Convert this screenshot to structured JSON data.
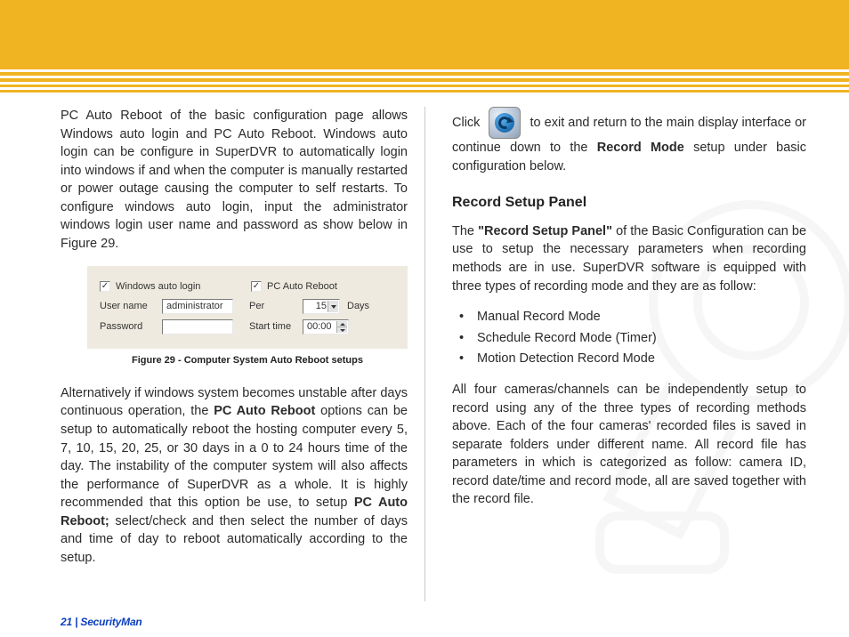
{
  "left": {
    "p1": "PC Auto Reboot of the basic configuration page allows Windows auto login and PC Auto Reboot.  Windows auto login can be configure in SuperDVR to automatically login into windows if and when the computer is manually restarted or power outage causing the computer to self restarts.  To configure windows auto login, input the administrator windows login user name and password as show below in Figure 29.",
    "fig": {
      "chk_win_label": "Windows auto login",
      "chk_pc_label": "PC Auto Reboot",
      "user_label": "User name",
      "user_value": "administrator",
      "per_label": "Per",
      "per_value": "15",
      "per_unit": "Days",
      "pwd_label": "Password",
      "pwd_value": "",
      "start_label": "Start time",
      "start_value": "00:00"
    },
    "caption": "Figure 29 - Computer System Auto Reboot setups",
    "p2a": "Alternatively if windows system becomes unstable after days continuous operation, the ",
    "p2b": "PC Auto Reboot",
    "p2c": " options can be setup to automatically reboot the hosting computer every 5, 7, 10, 15, 20, 25, or 30 days in a 0 to 24 hours time of the day.  The instability of the computer system will also affects the performance of SuperDVR as a whole.  It is highly recommended that this option be use, to setup ",
    "p2d": "PC Auto Reboot;",
    "p2e": " select/check   and then select the number of days and time of day to reboot automatically according to the setup."
  },
  "right": {
    "p1a": "Click ",
    "p1b": " to exit and return to the main display interface or continue down to the ",
    "p1c": "Record Mode",
    "p1d": " setup under basic configuration below.",
    "heading": "Record Setup Panel",
    "p2a": "The ",
    "p2b": "\"Record Setup Panel\"",
    "p2c": " of the Basic Configuration can be use to setup the necessary parameters when recording methods are in use.  SuperDVR software is equipped with three types of recording mode and they are as follow:",
    "bullets": [
      "Manual Record Mode",
      "Schedule Record Mode (Timer)",
      "Motion Detection Record Mode"
    ],
    "p3": "All four cameras/channels can be independently setup to record using any of the three types of recording methods above.  Each of the four cameras' recorded files is saved in separate folders under different name. All record file has parameters in which is categorized as follow: camera ID, record date/time and record mode, all are saved together with the record file."
  },
  "footer": {
    "page": "21",
    "sep": "  |  ",
    "brand": "SecurityMan"
  }
}
